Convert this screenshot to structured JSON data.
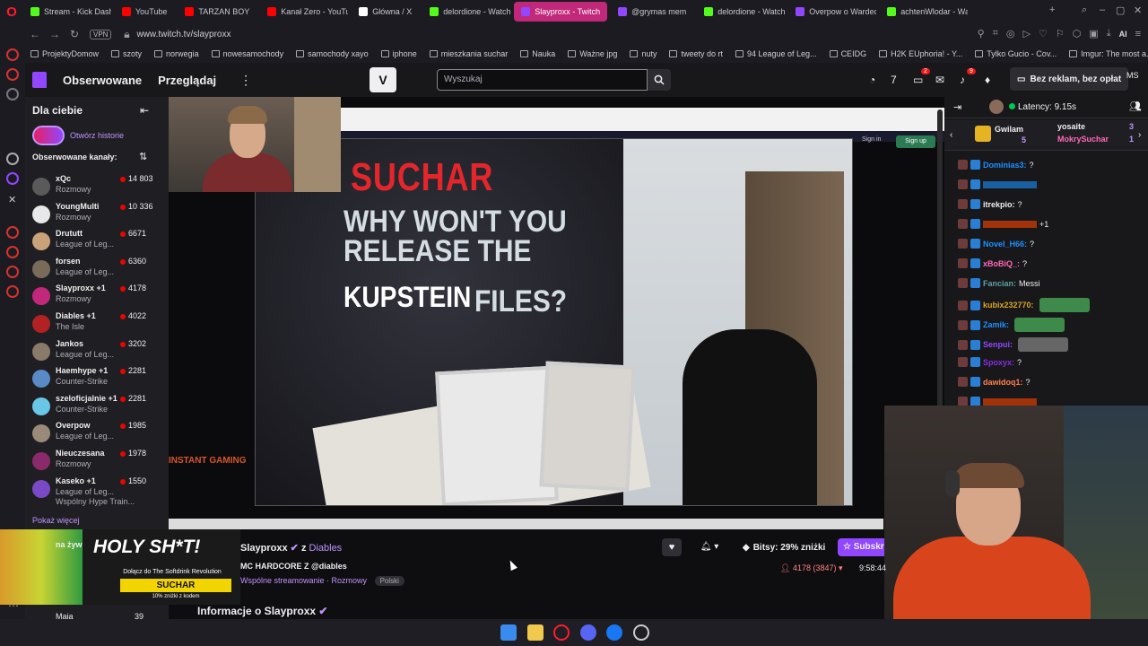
{
  "browser": {
    "tabs": [
      {
        "label": "Stream - Kick Dash",
        "color": "#53fc18"
      },
      {
        "label": "YouTube",
        "color": "#ff0000"
      },
      {
        "label": "TARZAN BOY",
        "color": "#ff0000"
      },
      {
        "label": "Kanał Zero - YouTu",
        "color": "#ff0000"
      },
      {
        "label": "Główna / X",
        "color": "#ffffff"
      },
      {
        "label": "delordione - Watch",
        "color": "#53fc18"
      },
      {
        "label": "Slayproxx - Twitch",
        "color": "#9147ff"
      },
      {
        "label": "@grymas mem",
        "color": "#9147ff"
      },
      {
        "label": "delordione - Watch",
        "color": "#53fc18"
      },
      {
        "label": "Overpow o Wardec",
        "color": "#9147ff"
      },
      {
        "label": "achtenWlodar - Wa",
        "color": "#53fc18"
      }
    ],
    "url": "www.twitch.tv/slayproxx",
    "vpn": "VPN",
    "bookmarks": [
      "ProjektyDomow",
      "szoty",
      "norwegia",
      "nowesamochody",
      "samochody xayo",
      "iphone",
      "mieszkania suchar",
      "Nauka",
      "Ważne jpg",
      "nuty",
      "tweety do rt",
      "94 League of Leg...",
      "CEIDG",
      "H2K EUphoria! - Y...",
      "Tylko Gucio - Cov...",
      "Imgur: The most a..."
    ]
  },
  "twitch_nav": {
    "following": "Obserwowane",
    "browse": "Przeglądaj",
    "search_placeholder": "Wyszukaj",
    "no_ads": "Bez reklam, bez opłat",
    "notif_badge_1": "2",
    "notif_badge_2": "9",
    "user_initials": "MS"
  },
  "sidebar": {
    "for_you": "Dla ciebie",
    "open_stories": "Otwórz historie",
    "followed_channels": "Obserwowane kanały:",
    "show_more": "Pokaż więcej",
    "bottom_name": "Maja",
    "bottom_count": "39",
    "channels": [
      {
        "name": "xQc",
        "game": "Rozmowy",
        "viewers": "14 803",
        "color": "#5a5a5a"
      },
      {
        "name": "YoungMulti",
        "game": "Rozmowy",
        "viewers": "10 336",
        "color": "#e8e8e8"
      },
      {
        "name": "Drututt",
        "game": "League of Leg...",
        "viewers": "6671",
        "color": "#c9a27a"
      },
      {
        "name": "forsen",
        "game": "League of Leg...",
        "viewers": "6360",
        "color": "#7a6a5a"
      },
      {
        "name": "Slayproxx +1",
        "game": "Rozmowy",
        "viewers": "4178",
        "color": "#c2287a"
      },
      {
        "name": "Diables +1",
        "game": "The Isle",
        "viewers": "4022",
        "color": "#b22222"
      },
      {
        "name": "Jankos",
        "game": "League of Leg...",
        "viewers": "3202",
        "color": "#8a7a6a"
      },
      {
        "name": "Haemhype +1",
        "game": "Counter-Strike",
        "viewers": "2281",
        "color": "#5a8ac6"
      },
      {
        "name": "szeloficjalnie +1",
        "game": "Counter-Strike",
        "viewers": "2281",
        "color": "#6ac6e6"
      },
      {
        "name": "Overpow",
        "game": "League of Leg...",
        "viewers": "1985",
        "color": "#9a8a7a"
      },
      {
        "name": "Nieuczesana",
        "game": "Rozmowy",
        "viewers": "1978",
        "color": "#8a2a6a"
      },
      {
        "name": "Kaseko +1",
        "game": "League of Leg...",
        "game2": "Wspólny Hype Train...",
        "viewers": "1550",
        "color": "#7a4ac6"
      }
    ]
  },
  "video": {
    "title_red": "SUCHAR",
    "title_line1": "WHY WON'T YOU",
    "title_line2": "RELEASE THE",
    "title_kup": "KUPSTEIN",
    "title_files": "FILES?",
    "signin": "Sign in",
    "signup": "Sign up",
    "instant_gaming": "INSTANT GAMING"
  },
  "chat": {
    "latency": "Latency: 9.15s",
    "gift_user1": "Gwilam",
    "gift_count1": "5",
    "gift_user2": "yosaite",
    "gift_count2": "3",
    "gift_user3": "MokrySuchar",
    "gift_count3": "1",
    "messages": [
      {
        "user": "Dominias3:",
        "text": "?",
        "color": "#1e90ff"
      },
      {
        "user": "",
        "text": "",
        "color": "#1e90ff"
      },
      {
        "user": "itrekpio:",
        "text": "?",
        "color": "#efeff1"
      },
      {
        "user": "",
        "text": "+1",
        "color": "#ff4500"
      },
      {
        "user": "Novel_H66:",
        "text": "?",
        "color": "#1e90ff"
      },
      {
        "user": "xBoBiQ_:",
        "text": "?",
        "color": "#ff69b4"
      },
      {
        "user": "Fancian:",
        "text": "Messi",
        "color": "#5f9ea0"
      },
      {
        "user": "kubix232770:",
        "text": "",
        "color": "#daa520"
      },
      {
        "user": "Zamik:",
        "text": "",
        "color": "#1e90ff"
      },
      {
        "user": "Senpui:",
        "text": "",
        "color": "#9147ff"
      },
      {
        "user": "Spoxyx:",
        "text": "?",
        "color": "#8a2be2"
      },
      {
        "user": "dawidoq1:",
        "text": "?",
        "color": "#ff7f50"
      },
      {
        "user": "",
        "text": "",
        "color": "#ff4500"
      }
    ]
  },
  "stream_info": {
    "streamer": "Slayproxx",
    "with": "z",
    "partner": "Diables",
    "title": "MC HARDCORE Z @diables",
    "mention": "@diables",
    "category": "Wspólne streamowanie · Rozmowy",
    "language": "Polski",
    "bits": "Bitsy: 29% zniżki",
    "subscribe": "Subskrybuj",
    "viewers": "4178 (3847)",
    "uptime": "9:58:44",
    "about": "Informacje o Slayproxx"
  },
  "ad": {
    "headline": "HOLY SH*T!",
    "sub": "Dołącz do The Softdrink Revolution",
    "code": "SUCHAR",
    "fine": "10% zniżki z kodem",
    "partial": "na żyw"
  }
}
